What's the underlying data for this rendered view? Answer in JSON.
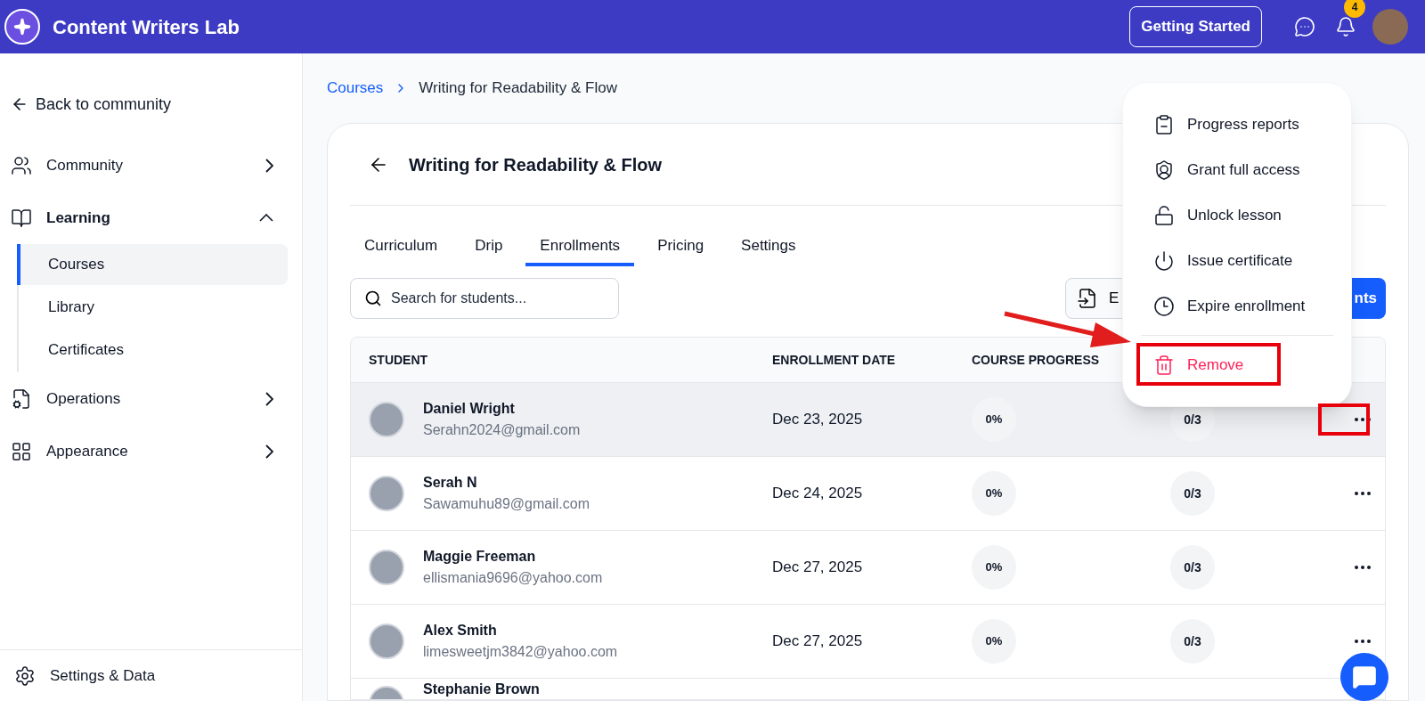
{
  "app": {
    "title": "Content Writers Lab",
    "getting_started": "Getting Started",
    "notification_count": "4"
  },
  "sidebar": {
    "back": "Back to community",
    "items": [
      {
        "label": "Community",
        "expanded": false
      },
      {
        "label": "Learning",
        "expanded": true,
        "children": [
          {
            "label": "Courses",
            "selected": true
          },
          {
            "label": "Library",
            "selected": false
          },
          {
            "label": "Certificates",
            "selected": false
          }
        ]
      },
      {
        "label": "Operations",
        "expanded": false
      },
      {
        "label": "Appearance",
        "expanded": false
      }
    ],
    "footer": "Settings & Data"
  },
  "breadcrumb": [
    "Courses",
    "Writing for Readability & Flow"
  ],
  "course": {
    "title": "Writing for Readability & Flow",
    "tabs": [
      {
        "label": "Curriculum",
        "selected": false
      },
      {
        "label": "Drip",
        "selected": false
      },
      {
        "label": "Enrollments",
        "selected": true
      },
      {
        "label": "Pricing",
        "selected": false
      },
      {
        "label": "Settings",
        "selected": false
      }
    ],
    "search": {
      "placeholder": "Search for students..."
    },
    "export_button": "E",
    "primary_button": "nts",
    "table": {
      "columns": [
        "STUDENT",
        "ENROLLMENT DATE",
        "COURSE PROGRESS"
      ],
      "rows": [
        {
          "name": "Daniel Wright",
          "email": "Serahn2024@gmail.com",
          "date": "Dec 23, 2025",
          "progress": "0%",
          "column_4": "0/3",
          "highlighted": true
        },
        {
          "name": "Serah N",
          "email": "Sawamuhu89@gmail.com",
          "date": "Dec 24, 2025",
          "progress": "0%",
          "column_4": "0/3",
          "highlighted": false
        },
        {
          "name": "Maggie Freeman",
          "email": "ellismania9696@yahoo.com",
          "date": "Dec 27, 2025",
          "progress": "0%",
          "column_4": "0/3",
          "highlighted": false
        },
        {
          "name": "Alex Smith",
          "email": "limesweetjm3842@yahoo.com",
          "date": "Dec 27, 2025",
          "progress": "0%",
          "column_4": "0/3",
          "highlighted": false
        },
        {
          "name": "Stephanie Brown"
        }
      ]
    }
  },
  "menu": {
    "items": [
      {
        "label": "Progress reports",
        "kind": "normal"
      },
      {
        "label": "Grant full access",
        "kind": "normal"
      },
      {
        "label": "Unlock lesson",
        "kind": "normal"
      },
      {
        "label": "Issue certificate",
        "kind": "normal"
      },
      {
        "label": "Expire enrollment",
        "kind": "normal"
      },
      {
        "label": "Remove",
        "kind": "danger"
      }
    ]
  }
}
